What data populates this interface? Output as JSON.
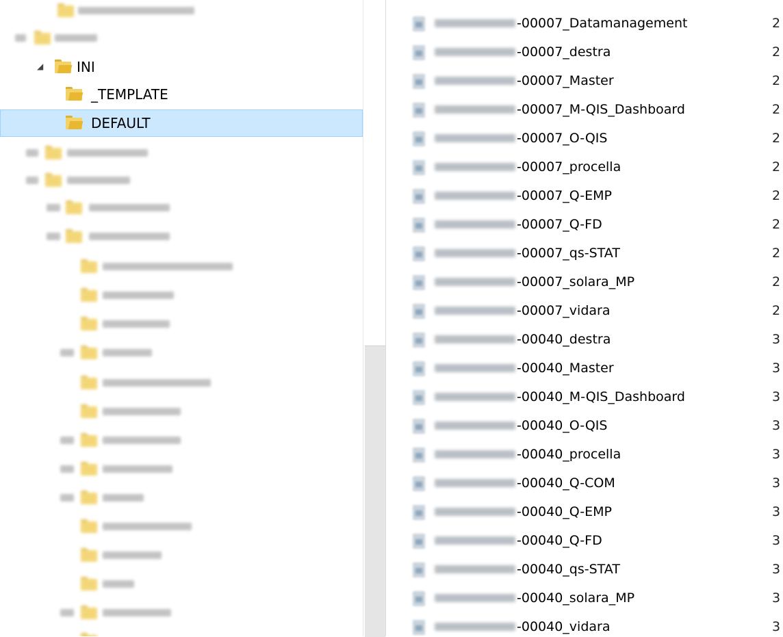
{
  "tree": {
    "ini_label": "INI",
    "template_label": "_TEMPLATE",
    "default_label": "DEFAULT"
  },
  "files": [
    {
      "name": "-00007_Datamanagement",
      "col": "2"
    },
    {
      "name": "-00007_destra",
      "col": "2"
    },
    {
      "name": "-00007_Master",
      "col": "2"
    },
    {
      "name": "-00007_M-QIS_Dashboard",
      "col": "2"
    },
    {
      "name": "-00007_O-QIS",
      "col": "2"
    },
    {
      "name": "-00007_procella",
      "col": "2"
    },
    {
      "name": "-00007_Q-EMP",
      "col": "2"
    },
    {
      "name": "-00007_Q-FD",
      "col": "2"
    },
    {
      "name": "-00007_qs-STAT",
      "col": "2"
    },
    {
      "name": "-00007_solara_MP",
      "col": "2"
    },
    {
      "name": "-00007_vidara",
      "col": "2"
    },
    {
      "name": "-00040_destra",
      "col": "3"
    },
    {
      "name": "-00040_Master",
      "col": "3"
    },
    {
      "name": "-00040_M-QIS_Dashboard",
      "col": "3"
    },
    {
      "name": "-00040_O-QIS",
      "col": "3"
    },
    {
      "name": "-00040_procella",
      "col": "3"
    },
    {
      "name": "-00040_Q-COM",
      "col": "3"
    },
    {
      "name": "-00040_Q-EMP",
      "col": "3"
    },
    {
      "name": "-00040_Q-FD",
      "col": "3"
    },
    {
      "name": "-00040_qs-STAT",
      "col": "3"
    },
    {
      "name": "-00040_solara_MP",
      "col": "3"
    },
    {
      "name": "-00040_vidara",
      "col": "3"
    }
  ]
}
